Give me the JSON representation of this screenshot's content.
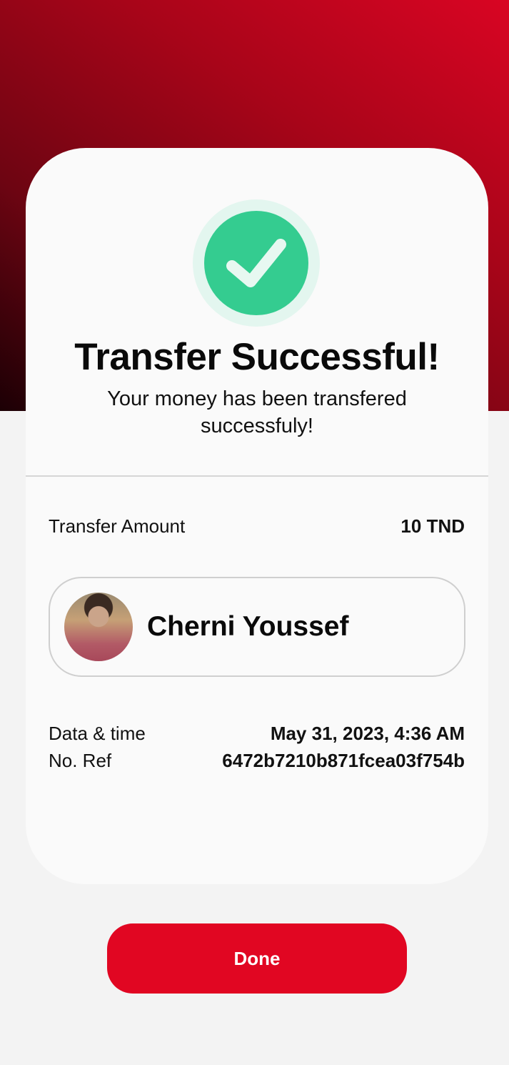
{
  "colors": {
    "brand_red": "#e10622",
    "success_green": "#34cc90",
    "hero_gradient_start": "#d90523",
    "hero_gradient_end": "#1c0005"
  },
  "status": {
    "icon": "check-icon",
    "title": "Transfer Successful!",
    "subtitle": "Your money has been transfered successfuly!"
  },
  "amount": {
    "label": "Transfer Amount",
    "value": "10 TND"
  },
  "recipient": {
    "name": "Cherni Youssef"
  },
  "details": {
    "datetime_label": "Data & time",
    "datetime_value": "May 31, 2023, 4:36 AM",
    "ref_label": "No. Ref",
    "ref_value": "6472b7210b871fcea03f754b"
  },
  "actions": {
    "done_label": "Done"
  }
}
